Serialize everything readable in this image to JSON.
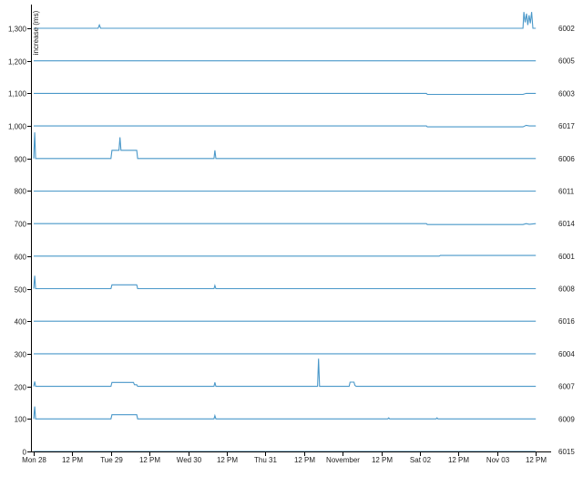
{
  "chart_data": {
    "type": "line",
    "title": "",
    "xlabel": "",
    "ylabel": "increase (ms)",
    "ylim": [
      0,
      1350
    ],
    "grid": false,
    "legend": "right",
    "color": "#4a98c9",
    "x_ticks": [
      "Mon 28",
      "12 PM",
      "Tue 29",
      "12 PM",
      "Wed 30",
      "12 PM",
      "Thu 31",
      "12 PM",
      "November",
      "12 PM",
      "Sat 02",
      "12 PM",
      "Nov 03",
      "12 PM"
    ],
    "y_ticks": [
      0,
      100,
      200,
      300,
      400,
      500,
      600,
      700,
      800,
      900,
      1000,
      1100,
      1200,
      1300
    ],
    "y_tick_labels": [
      "0",
      "100",
      "200",
      "300",
      "400",
      "500",
      "600",
      "700",
      "800",
      "900",
      "1,000",
      "1,100",
      "1,200",
      "1,300"
    ],
    "series": [
      {
        "name": "6002",
        "values": [
          [
            0,
            1300
          ],
          [
            20,
            1300
          ],
          [
            20.4,
            1310
          ],
          [
            20.8,
            1300
          ],
          [
            152,
            1300
          ],
          [
            152.3,
            1350
          ],
          [
            152.7,
            1318
          ],
          [
            153.1,
            1345
          ],
          [
            153.5,
            1310
          ],
          [
            153.9,
            1340
          ],
          [
            154.3,
            1315
          ],
          [
            154.7,
            1350
          ],
          [
            155.1,
            1300
          ],
          [
            156,
            1300
          ]
        ]
      },
      {
        "name": "6005",
        "values": [
          [
            0,
            1200
          ],
          [
            156,
            1200
          ]
        ]
      },
      {
        "name": "6003",
        "values": [
          [
            0,
            1100
          ],
          [
            122,
            1100
          ],
          [
            122.3,
            1097
          ],
          [
            152,
            1097
          ],
          [
            153,
            1100
          ],
          [
            156,
            1100
          ]
        ]
      },
      {
        "name": "6017",
        "values": [
          [
            0,
            1000
          ],
          [
            122,
            1000
          ],
          [
            122.3,
            997
          ],
          [
            152,
            997
          ],
          [
            153,
            1002
          ],
          [
            154,
            1000
          ],
          [
            156,
            1000
          ]
        ]
      },
      {
        "name": "6006",
        "values": [
          [
            0,
            900
          ],
          [
            0.3,
            980
          ],
          [
            0.6,
            900
          ],
          [
            24,
            900
          ],
          [
            24.3,
            925
          ],
          [
            26.5,
            925
          ],
          [
            26.8,
            965
          ],
          [
            27.1,
            925
          ],
          [
            32,
            925
          ],
          [
            32.3,
            900
          ],
          [
            56,
            900
          ],
          [
            56.3,
            925
          ],
          [
            56.6,
            900
          ],
          [
            156,
            900
          ]
        ]
      },
      {
        "name": "6011",
        "values": [
          [
            0,
            800
          ],
          [
            156,
            800
          ]
        ]
      },
      {
        "name": "6014",
        "values": [
          [
            0,
            700
          ],
          [
            122,
            700
          ],
          [
            122.3,
            697
          ],
          [
            152,
            697
          ],
          [
            153,
            700
          ],
          [
            154,
            698
          ],
          [
            156,
            700
          ]
        ]
      },
      {
        "name": "6001",
        "values": [
          [
            0,
            600
          ],
          [
            126,
            600
          ],
          [
            126.3,
            602
          ],
          [
            156,
            602
          ]
        ]
      },
      {
        "name": "6008",
        "values": [
          [
            0,
            500
          ],
          [
            0.3,
            540
          ],
          [
            0.6,
            500
          ],
          [
            24,
            500
          ],
          [
            24.3,
            512
          ],
          [
            32,
            512
          ],
          [
            32.3,
            500
          ],
          [
            56,
            500
          ],
          [
            56.3,
            510
          ],
          [
            56.6,
            500
          ],
          [
            156,
            500
          ]
        ]
      },
      {
        "name": "6016",
        "values": [
          [
            0,
            400
          ],
          [
            156,
            400
          ]
        ]
      },
      {
        "name": "6004",
        "values": [
          [
            0,
            300
          ],
          [
            156,
            300
          ]
        ]
      },
      {
        "name": "6007",
        "values": [
          [
            0,
            200
          ],
          [
            0.3,
            215
          ],
          [
            0.6,
            200
          ],
          [
            24,
            200
          ],
          [
            24.3,
            212
          ],
          [
            31,
            212
          ],
          [
            31.3,
            205
          ],
          [
            32,
            205
          ],
          [
            32.3,
            200
          ],
          [
            56,
            200
          ],
          [
            56.3,
            212
          ],
          [
            56.6,
            200
          ],
          [
            88.2,
            200
          ],
          [
            88.5,
            285
          ],
          [
            88.8,
            200
          ],
          [
            98,
            200
          ],
          [
            98.3,
            213
          ],
          [
            99.5,
            213
          ],
          [
            99.8,
            203
          ],
          [
            100.2,
            200
          ],
          [
            156,
            200
          ]
        ]
      },
      {
        "name": "6009",
        "values": [
          [
            0,
            100
          ],
          [
            0.3,
            138
          ],
          [
            0.6,
            100
          ],
          [
            24,
            100
          ],
          [
            24.3,
            113
          ],
          [
            32,
            113
          ],
          [
            32.3,
            100
          ],
          [
            56,
            100
          ],
          [
            56.3,
            110
          ],
          [
            56.6,
            100
          ],
          [
            110,
            100
          ],
          [
            110.3,
            103
          ],
          [
            110.6,
            100
          ],
          [
            125,
            100
          ],
          [
            125.3,
            103
          ],
          [
            125.6,
            100
          ],
          [
            156,
            100
          ]
        ]
      },
      {
        "name": "6015",
        "values": [
          [
            0,
            0
          ],
          [
            156,
            0
          ]
        ]
      }
    ]
  }
}
